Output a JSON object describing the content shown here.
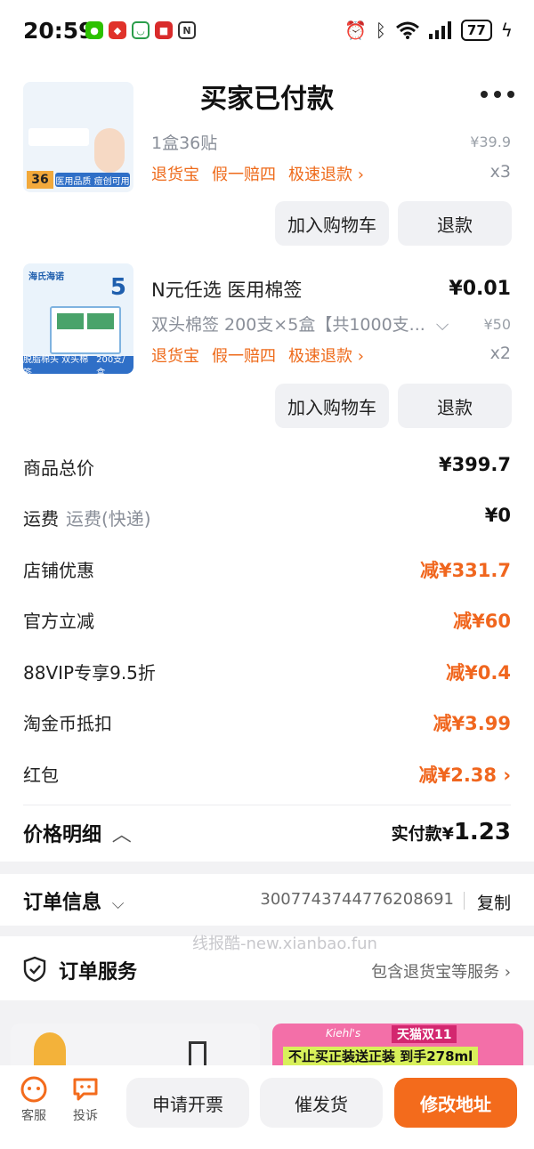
{
  "status_bar": {
    "time": "20:59",
    "battery": "77",
    "left_icons": [
      "wechat-icon",
      "store-icon",
      "mi-icon",
      "app-icon",
      "nfc-icon"
    ],
    "right_icons": [
      "alarm-icon",
      "bluetooth-icon",
      "wifi-icon",
      "signal-icon",
      "charging-icon"
    ]
  },
  "nav": {
    "title": "买家已付款"
  },
  "items": [
    {
      "spec": "1盒36贴",
      "orig_price": "¥39.9",
      "qty": "x3",
      "tags": [
        "退货宝",
        "假一赔四",
        "极速退款 ›"
      ],
      "add_cart": "加入购物车",
      "refund": "退款",
      "thumb_text": {
        "badge": "36",
        "caption": "医用品质 痘创可用"
      }
    },
    {
      "name": "N元任选 医用棉签",
      "spec": "双头棉签 200支×5盒【共1000支...",
      "price": "¥0.01",
      "orig_price": "¥50",
      "qty": "x2",
      "tags": [
        "退货宝",
        "假一赔四",
        "极速退款 ›"
      ],
      "add_cart": "加入购物车",
      "refund": "退款",
      "thumb_text": {
        "brand": "海氏海诺",
        "badge": "5",
        "caption": "脱脂棉头 双头棉签",
        "caption2": "200支/盒"
      }
    }
  ],
  "price_rows": [
    {
      "label": "商品总价",
      "sub": "",
      "value": "¥399.7",
      "highlight": false
    },
    {
      "label": "运费",
      "sub": "运费(快递)",
      "value": "¥0",
      "highlight": false
    },
    {
      "label": "店铺优惠",
      "sub": "",
      "value": "减¥331.7",
      "highlight": true
    },
    {
      "label": "官方立减",
      "sub": "",
      "value": "减¥60",
      "highlight": true
    },
    {
      "label": "88VIP专享9.5折",
      "sub": "",
      "value": "减¥0.4",
      "highlight": true
    },
    {
      "label": "淘金币抵扣",
      "sub": "",
      "value": "减¥3.99",
      "highlight": true
    },
    {
      "label": "红包",
      "sub": "",
      "value": "减¥2.38 ›",
      "highlight": true
    }
  ],
  "summary": {
    "label": "价格明细",
    "paid_label": "实付款",
    "paid_currency": "¥",
    "paid_value": "1.23"
  },
  "order_info": {
    "label": "订单信息",
    "order_no": "3007743744776208691",
    "copy": "复制"
  },
  "watermark": "线报酷-new.xianbao.fun",
  "order_service": {
    "label": "订单服务",
    "value": "包含退货宝等服务 ›"
  },
  "banner_right": {
    "brand": "Kiehl's",
    "event": "天猫双11",
    "slogan": "不止买正装送正装 到手278ml"
  },
  "bottom": {
    "service": "客服",
    "complain": "投诉",
    "invoice": "申请开票",
    "urge": "催发货",
    "change_address": "修改地址"
  },
  "colors": {
    "accent": "#f36b1c",
    "orange_text": "#f0661e"
  }
}
